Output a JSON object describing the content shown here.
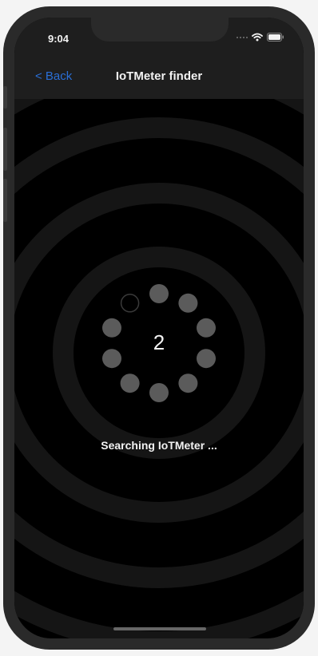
{
  "status_bar": {
    "time": "9:04",
    "icons": [
      "signal-icon",
      "wifi-icon",
      "battery-icon"
    ]
  },
  "nav": {
    "back_label": "< Back",
    "title": "IoTMeter finder"
  },
  "spinner": {
    "count": "2",
    "dot_count": 10
  },
  "status_text": "Searching IoTMeter ...",
  "colors": {
    "background": "#000000",
    "bar": "#1e1e1e",
    "accent": "#2a6fd6",
    "text": "#f2f2f2",
    "spinner_dot": "#5b5b5b"
  }
}
